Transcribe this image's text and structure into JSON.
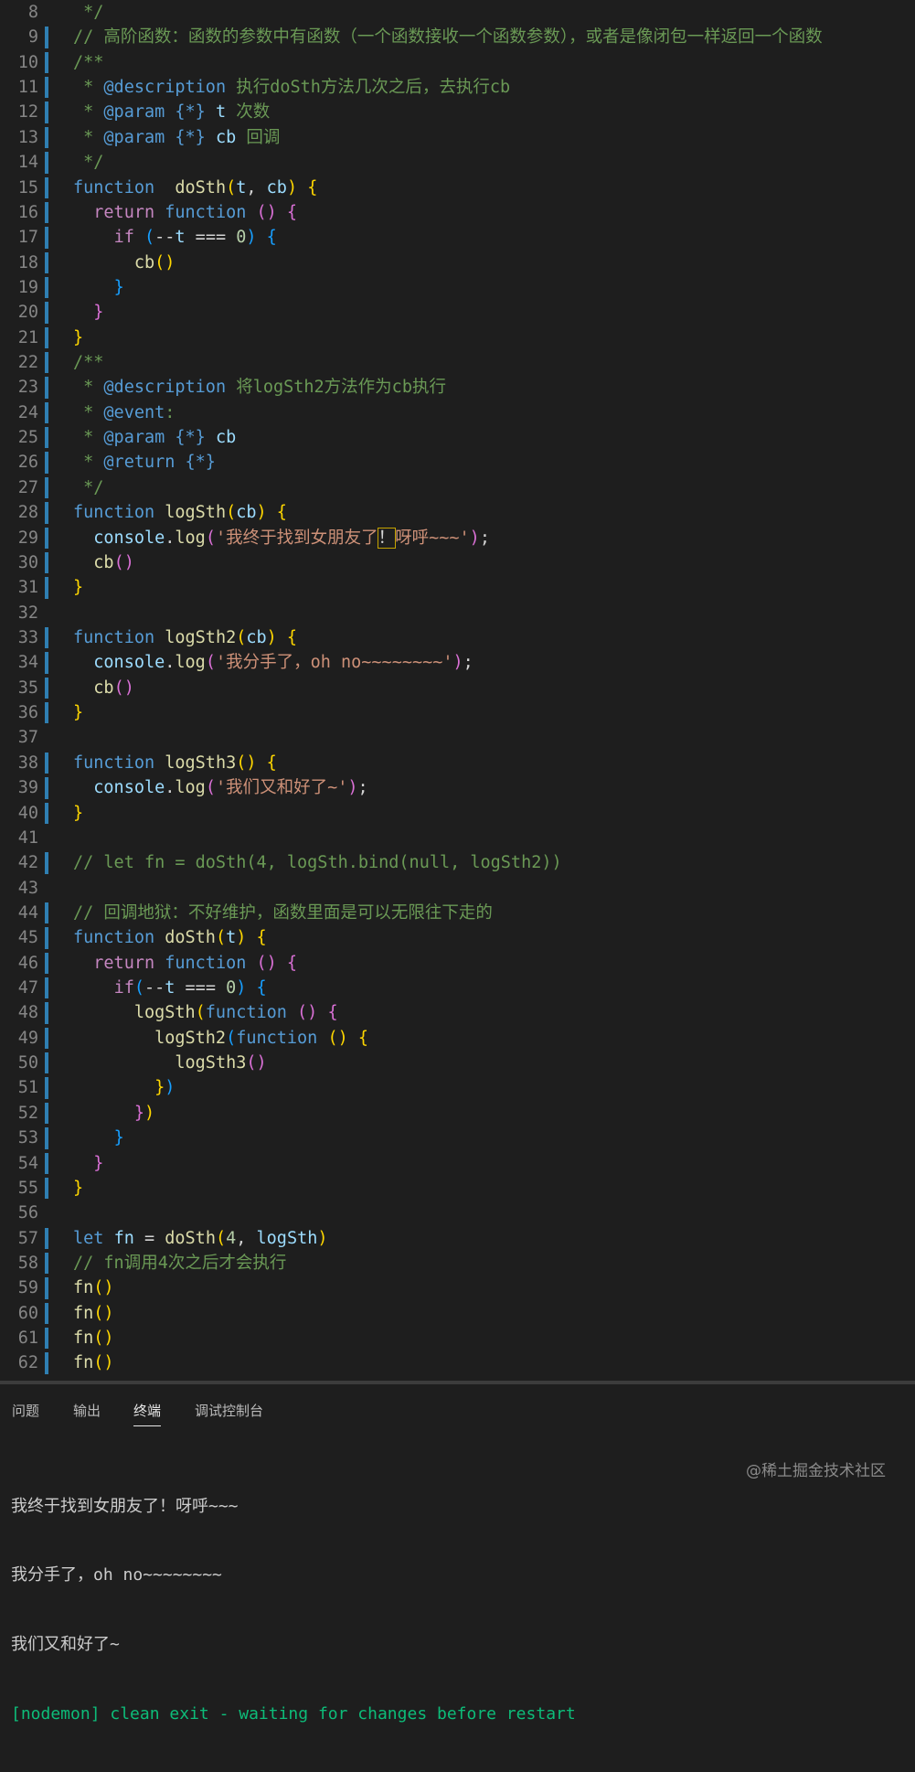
{
  "editor": {
    "lines": [
      {
        "n": "8",
        "segs": [
          [
            "cm",
            " */"
          ]
        ]
      },
      {
        "n": "9",
        "segs": [
          [
            "cm",
            "// 高阶函数：函数的参数中有函数（一个函数接收一个函数参数），或者是像闭包一样返回一个函数"
          ]
        ]
      },
      {
        "n": "10",
        "segs": [
          [
            "cm",
            "/**"
          ]
        ]
      },
      {
        "n": "11",
        "segs": [
          [
            "cm",
            " * "
          ],
          [
            "tag",
            "@description"
          ],
          [
            "cm",
            " 执行doSth方法几次之后，去执行cb"
          ]
        ]
      },
      {
        "n": "12",
        "segs": [
          [
            "cm",
            " * "
          ],
          [
            "tag",
            "@param"
          ],
          [
            "cm",
            " "
          ],
          [
            "kw",
            "{*}"
          ],
          [
            "cm",
            " "
          ],
          [
            "par",
            "t"
          ],
          [
            "cm",
            " 次数"
          ]
        ]
      },
      {
        "n": "13",
        "segs": [
          [
            "cm",
            " * "
          ],
          [
            "tag",
            "@param"
          ],
          [
            "cm",
            " "
          ],
          [
            "kw",
            "{*}"
          ],
          [
            "cm",
            " "
          ],
          [
            "par",
            "cb"
          ],
          [
            "cm",
            " 回调"
          ]
        ]
      },
      {
        "n": "14",
        "segs": [
          [
            "cm",
            " */"
          ]
        ]
      },
      {
        "n": "15",
        "segs": [
          [
            "kw",
            "function"
          ],
          [
            "",
            "  "
          ],
          [
            "fn",
            "doSth"
          ],
          [
            "b1",
            "("
          ],
          [
            "par",
            "t"
          ],
          [
            "",
            ", "
          ],
          [
            "par",
            "cb"
          ],
          [
            "b1",
            ")"
          ],
          [
            "",
            ""
          ],
          [
            "b1",
            " {"
          ]
        ]
      },
      {
        "n": "16",
        "segs": [
          [
            "",
            "  "
          ],
          [
            "kw2",
            "return"
          ],
          [
            "",
            " "
          ],
          [
            "kw",
            "function"
          ],
          [
            "",
            " "
          ],
          [
            "b2",
            "()"
          ],
          [
            "",
            " "
          ],
          [
            "b2",
            "{"
          ]
        ]
      },
      {
        "n": "17",
        "segs": [
          [
            "",
            "    "
          ],
          [
            "kw2",
            "if"
          ],
          [
            "",
            " "
          ],
          [
            "b3",
            "("
          ],
          [
            "",
            "--"
          ],
          [
            "par",
            "t"
          ],
          [
            "",
            " === "
          ],
          [
            "num",
            "0"
          ],
          [
            "b3",
            ")"
          ],
          [
            "",
            " "
          ],
          [
            "b3",
            "{"
          ]
        ]
      },
      {
        "n": "18",
        "segs": [
          [
            "",
            "      "
          ],
          [
            "fn",
            "cb"
          ],
          [
            "b1",
            "()"
          ]
        ]
      },
      {
        "n": "19",
        "segs": [
          [
            "",
            "    "
          ],
          [
            "b3",
            "}"
          ]
        ]
      },
      {
        "n": "20",
        "segs": [
          [
            "",
            "  "
          ],
          [
            "b2",
            "}"
          ]
        ]
      },
      {
        "n": "21",
        "segs": [
          [
            "b1",
            "}"
          ]
        ]
      },
      {
        "n": "22",
        "segs": [
          [
            "cm",
            "/**"
          ]
        ]
      },
      {
        "n": "23",
        "segs": [
          [
            "cm",
            " * "
          ],
          [
            "tag",
            "@description"
          ],
          [
            "cm",
            " 将logSth2方法作为cb执行"
          ]
        ]
      },
      {
        "n": "24",
        "segs": [
          [
            "cm",
            " * "
          ],
          [
            "tag",
            "@event"
          ],
          [
            "cm",
            ":"
          ]
        ]
      },
      {
        "n": "25",
        "segs": [
          [
            "cm",
            " * "
          ],
          [
            "tag",
            "@param"
          ],
          [
            "cm",
            " "
          ],
          [
            "kw",
            "{*}"
          ],
          [
            "cm",
            " "
          ],
          [
            "par",
            "cb"
          ]
        ]
      },
      {
        "n": "26",
        "segs": [
          [
            "cm",
            " * "
          ],
          [
            "tag",
            "@return"
          ],
          [
            "cm",
            " "
          ],
          [
            "kw",
            "{*}"
          ]
        ]
      },
      {
        "n": "27",
        "segs": [
          [
            "cm",
            " */"
          ]
        ]
      },
      {
        "n": "28",
        "segs": [
          [
            "kw",
            "function"
          ],
          [
            "",
            " "
          ],
          [
            "fn",
            "logSth"
          ],
          [
            "b1",
            "("
          ],
          [
            "par",
            "cb"
          ],
          [
            "b1",
            ")"
          ],
          [
            "",
            " "
          ],
          [
            "b1",
            "{"
          ]
        ]
      },
      {
        "n": "29",
        "segs": [
          [
            "",
            "  "
          ],
          [
            "par",
            "console"
          ],
          [
            "",
            "."
          ],
          [
            "fn",
            "log"
          ],
          [
            "b2",
            "("
          ],
          [
            "str",
            "'我终于找到女朋友了"
          ],
          [
            "hl",
            "！"
          ],
          [
            "str",
            "呀呼~~~'"
          ],
          [
            "b2",
            ")"
          ],
          [
            "",
            ";"
          ]
        ]
      },
      {
        "n": "30",
        "segs": [
          [
            "",
            "  "
          ],
          [
            "fn",
            "cb"
          ],
          [
            "b2",
            "()"
          ]
        ]
      },
      {
        "n": "31",
        "segs": [
          [
            "b1",
            "}"
          ]
        ]
      },
      {
        "n": "32",
        "segs": []
      },
      {
        "n": "33",
        "segs": [
          [
            "kw",
            "function"
          ],
          [
            "",
            " "
          ],
          [
            "fn",
            "logSth2"
          ],
          [
            "b1",
            "("
          ],
          [
            "par",
            "cb"
          ],
          [
            "b1",
            ")"
          ],
          [
            "",
            " "
          ],
          [
            "b1",
            "{"
          ]
        ]
      },
      {
        "n": "34",
        "segs": [
          [
            "",
            "  "
          ],
          [
            "par",
            "console"
          ],
          [
            "",
            "."
          ],
          [
            "fn",
            "log"
          ],
          [
            "b2",
            "("
          ],
          [
            "str",
            "'我分手了，oh no~~~~~~~~'"
          ],
          [
            "b2",
            ")"
          ],
          [
            "",
            ";"
          ]
        ]
      },
      {
        "n": "35",
        "segs": [
          [
            "",
            "  "
          ],
          [
            "fn",
            "cb"
          ],
          [
            "b2",
            "()"
          ]
        ]
      },
      {
        "n": "36",
        "segs": [
          [
            "b1",
            "}"
          ]
        ]
      },
      {
        "n": "37",
        "segs": []
      },
      {
        "n": "38",
        "segs": [
          [
            "kw",
            "function"
          ],
          [
            "",
            " "
          ],
          [
            "fn",
            "logSth3"
          ],
          [
            "b1",
            "()"
          ],
          [
            "",
            " "
          ],
          [
            "b1",
            "{"
          ]
        ]
      },
      {
        "n": "39",
        "segs": [
          [
            "",
            "  "
          ],
          [
            "par",
            "console"
          ],
          [
            "",
            "."
          ],
          [
            "fn",
            "log"
          ],
          [
            "b2",
            "("
          ],
          [
            "str",
            "'我们又和好了~'"
          ],
          [
            "b2",
            ")"
          ],
          [
            "",
            ";"
          ]
        ]
      },
      {
        "n": "40",
        "segs": [
          [
            "b1",
            "}"
          ]
        ]
      },
      {
        "n": "41",
        "segs": []
      },
      {
        "n": "42",
        "segs": [
          [
            "cm",
            "// let fn = doSth(4, logSth.bind(null, logSth2))"
          ]
        ]
      },
      {
        "n": "43",
        "segs": []
      },
      {
        "n": "44",
        "segs": [
          [
            "cm",
            "// 回调地狱：不好维护，函数里面是可以无限往下走的"
          ]
        ]
      },
      {
        "n": "45",
        "segs": [
          [
            "kw",
            "function"
          ],
          [
            "",
            " "
          ],
          [
            "fn",
            "doSth"
          ],
          [
            "b1",
            "("
          ],
          [
            "par",
            "t"
          ],
          [
            "b1",
            ")"
          ],
          [
            "",
            " "
          ],
          [
            "b1",
            "{"
          ]
        ]
      },
      {
        "n": "46",
        "segs": [
          [
            "",
            "  "
          ],
          [
            "kw2",
            "return"
          ],
          [
            "",
            " "
          ],
          [
            "kw",
            "function"
          ],
          [
            "",
            " "
          ],
          [
            "b2",
            "()"
          ],
          [
            "",
            " "
          ],
          [
            "b2",
            "{"
          ]
        ]
      },
      {
        "n": "47",
        "segs": [
          [
            "",
            "    "
          ],
          [
            "kw2",
            "if"
          ],
          [
            "b3",
            "("
          ],
          [
            "",
            "--"
          ],
          [
            "par",
            "t"
          ],
          [
            "",
            " === "
          ],
          [
            "num",
            "0"
          ],
          [
            "b3",
            ")"
          ],
          [
            "",
            " "
          ],
          [
            "b3",
            "{"
          ]
        ]
      },
      {
        "n": "48",
        "segs": [
          [
            "",
            "      "
          ],
          [
            "fn",
            "logSth"
          ],
          [
            "b1",
            "("
          ],
          [
            "kw",
            "function"
          ],
          [
            "",
            " "
          ],
          [
            "b2",
            "()"
          ],
          [
            "",
            " "
          ],
          [
            "b2",
            "{"
          ]
        ]
      },
      {
        "n": "49",
        "segs": [
          [
            "",
            "        "
          ],
          [
            "fn",
            "logSth2"
          ],
          [
            "b3",
            "("
          ],
          [
            "kw",
            "function"
          ],
          [
            "",
            " "
          ],
          [
            "b1",
            "()"
          ],
          [
            "",
            " "
          ],
          [
            "b1",
            "{"
          ]
        ]
      },
      {
        "n": "50",
        "segs": [
          [
            "",
            "          "
          ],
          [
            "fn",
            "logSth3"
          ],
          [
            "b2",
            "()"
          ]
        ]
      },
      {
        "n": "51",
        "segs": [
          [
            "",
            "        "
          ],
          [
            "b1",
            "}"
          ],
          [
            "b3",
            ")"
          ]
        ]
      },
      {
        "n": "52",
        "segs": [
          [
            "",
            "      "
          ],
          [
            "b2",
            "}"
          ],
          [
            "b1",
            ")"
          ]
        ]
      },
      {
        "n": "53",
        "segs": [
          [
            "",
            "    "
          ],
          [
            "b3",
            "}"
          ]
        ]
      },
      {
        "n": "54",
        "segs": [
          [
            "",
            "  "
          ],
          [
            "b2",
            "}"
          ]
        ]
      },
      {
        "n": "55",
        "segs": [
          [
            "b1",
            "}"
          ]
        ]
      },
      {
        "n": "56",
        "segs": []
      },
      {
        "n": "57",
        "segs": [
          [
            "kw",
            "let"
          ],
          [
            "",
            " "
          ],
          [
            "par",
            "fn"
          ],
          [
            "",
            " = "
          ],
          [
            "fn",
            "doSth"
          ],
          [
            "b1",
            "("
          ],
          [
            "num",
            "4"
          ],
          [
            "",
            ", "
          ],
          [
            "par",
            "logSth"
          ],
          [
            "b1",
            ")"
          ]
        ]
      },
      {
        "n": "58",
        "segs": [
          [
            "cm",
            "// fn调用4次之后才会执行"
          ]
        ]
      },
      {
        "n": "59",
        "segs": [
          [
            "fn",
            "fn"
          ],
          [
            "b1",
            "()"
          ]
        ]
      },
      {
        "n": "60",
        "segs": [
          [
            "fn",
            "fn"
          ],
          [
            "b1",
            "()"
          ]
        ]
      },
      {
        "n": "61",
        "segs": [
          [
            "fn",
            "fn"
          ],
          [
            "b1",
            "()"
          ]
        ]
      },
      {
        "n": "62",
        "segs": [
          [
            "fn",
            "fn"
          ],
          [
            "b1",
            "()"
          ]
        ]
      }
    ]
  },
  "panel": {
    "tabs": [
      "问题",
      "输出",
      "终端",
      "调试控制台"
    ],
    "active_tab": "终端",
    "terminal_lines": [
      "我终于找到女朋友了！呀呼~~~",
      "我分手了，oh no~~~~~~~~",
      "我们又和好了~"
    ],
    "nodemon_line": "[nodemon] clean exit - waiting for changes before restart"
  },
  "watermark": "@稀土掘金技术社区",
  "colors": {
    "background": "#1e1e1e",
    "keyword": "#569cd6",
    "control": "#c586c0",
    "function": "#dcdcaa",
    "string": "#ce9178",
    "comment": "#6a9955",
    "number": "#b5cea8",
    "terminal_green": "#0dbc79"
  }
}
